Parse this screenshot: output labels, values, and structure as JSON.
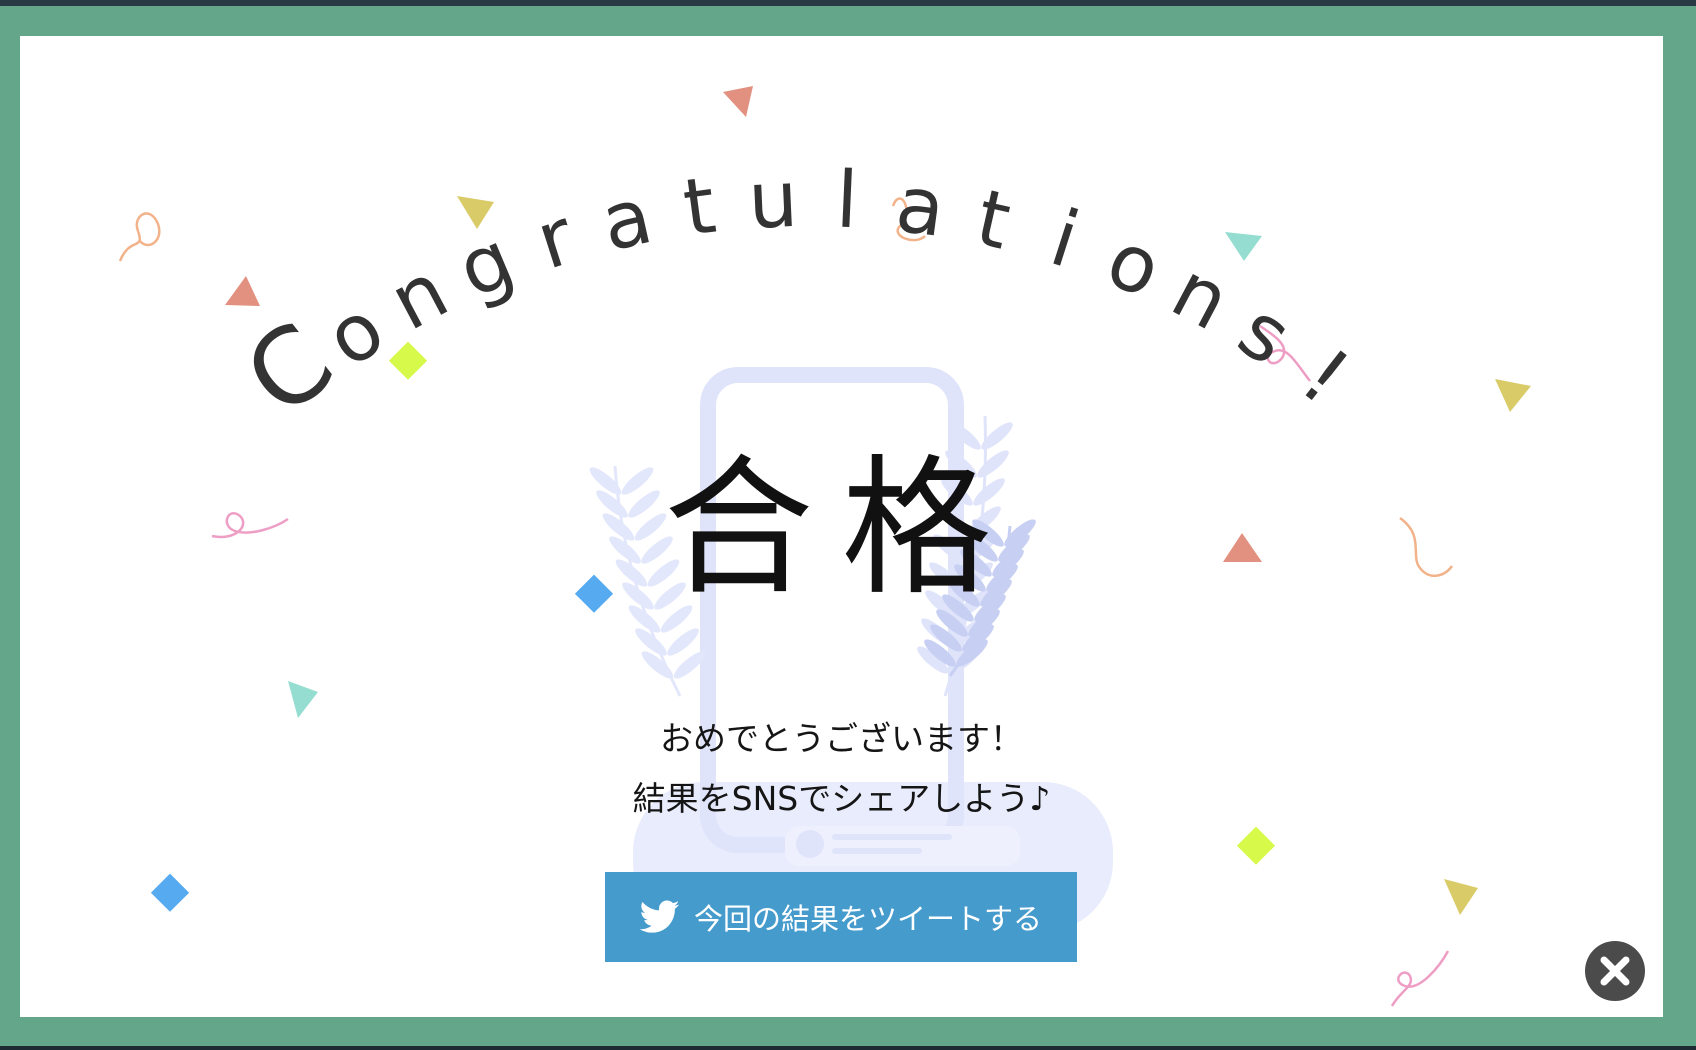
{
  "modal": {
    "headline": "Congratulations!",
    "result": "合格",
    "message_line1": "おめでとうございます！",
    "message_line2": "結果をSNSでシェアしよう♪",
    "tweet_button_label": "今回の結果をツイートする",
    "tweet_icon": "twitter-bird-icon",
    "close_icon": "close-icon"
  },
  "colors": {
    "frame": "#63a68a",
    "modal_background": "#ffffff",
    "tweet_button": "#469bcd",
    "close_button": "#4b4b4b",
    "headline": "#333333",
    "illustration": "#dfe4fb"
  }
}
